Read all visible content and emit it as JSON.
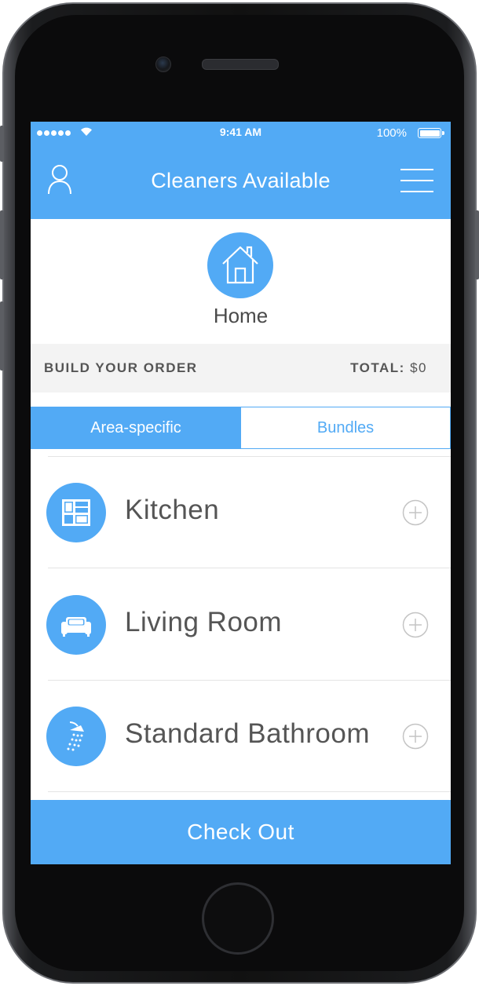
{
  "status_bar": {
    "time": "9:41 AM",
    "battery": "100%",
    "battery_level": 1.0
  },
  "nav": {
    "title": "Cleaners Available",
    "left_icon": "user-icon",
    "right_icon": "menu-icon"
  },
  "location": {
    "icon": "home-icon",
    "label": "Home"
  },
  "order": {
    "build_label": "BUILD YOUR ORDER",
    "total_label": "TOTAL:",
    "total_value": "$0"
  },
  "tabs": [
    {
      "label": "Area-specific",
      "selected": true
    },
    {
      "label": "Bundles",
      "selected": false
    }
  ],
  "items": [
    {
      "label": "Kitchen",
      "icon": "kitchen-icon",
      "action_icon": "add-circle-icon"
    },
    {
      "label": "Living Room",
      "icon": "sofa-icon",
      "action_icon": "add-circle-icon"
    },
    {
      "label": "Standard Bathroom",
      "icon": "shower-icon",
      "action_icon": "add-circle-icon"
    }
  ],
  "checkout": {
    "label": "Check Out"
  },
  "colors": {
    "accent": "#52aaf5",
    "order_bar_bg": "#f3f3f3",
    "text_dark": "#555555"
  }
}
